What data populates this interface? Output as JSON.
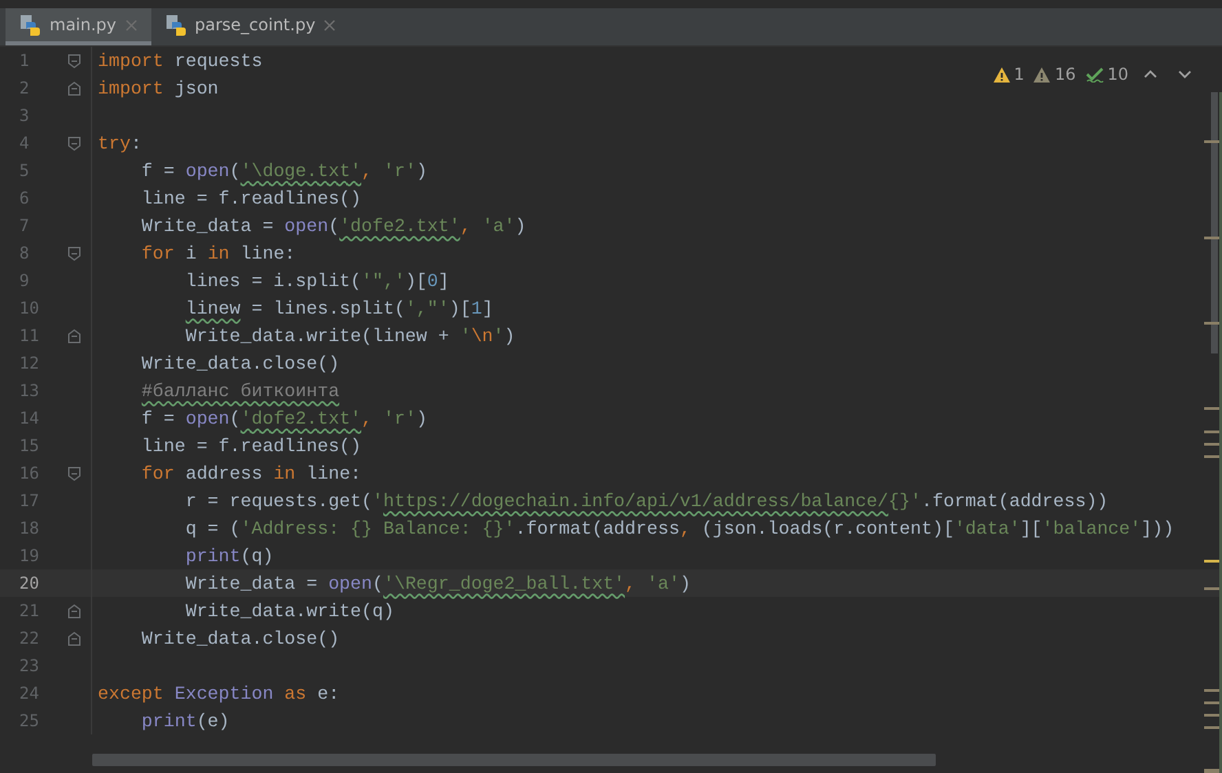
{
  "tabs": [
    {
      "label": "main.py",
      "selected": true
    },
    {
      "label": "parse_coint.py",
      "selected": false
    }
  ],
  "inspections": [
    {
      "kind": "warning",
      "count": "1"
    },
    {
      "kind": "weak",
      "count": "16"
    },
    {
      "kind": "typo",
      "count": "10"
    }
  ],
  "lines": [
    {
      "number": "1",
      "current": false,
      "fold_start": true,
      "fold_end": false,
      "tokens": [
        {
          "text": "import",
          "kind": "keyword"
        },
        {
          "text": " requests",
          "kind": "plain"
        }
      ]
    },
    {
      "number": "2",
      "current": false,
      "fold_start": false,
      "fold_end": true,
      "tokens": [
        {
          "text": "import",
          "kind": "keyword"
        },
        {
          "text": " json",
          "kind": "plain"
        }
      ]
    },
    {
      "number": "3",
      "current": false,
      "fold_start": false,
      "fold_end": false
    },
    {
      "number": "4",
      "current": false,
      "fold_start": true,
      "fold_end": false,
      "tokens": [
        {
          "text": "try",
          "kind": "keyword"
        },
        {
          "text": ":",
          "kind": "plain"
        }
      ]
    },
    {
      "number": "5",
      "current": false,
      "fold_start": false,
      "fold_end": false,
      "tokens": [
        {
          "text": "    f = ",
          "kind": "plain"
        },
        {
          "text": "open",
          "kind": "builtin"
        },
        {
          "text": "(",
          "kind": "plain"
        },
        {
          "text": "'\\doge.txt'",
          "kind": "string",
          "underlined": true
        },
        {
          "text": ", ",
          "kind": "keyword"
        },
        {
          "text": "'r'",
          "kind": "string"
        },
        {
          "text": ")",
          "kind": "plain"
        }
      ]
    },
    {
      "number": "6",
      "current": false,
      "fold_start": false,
      "fold_end": false,
      "tokens": [
        {
          "text": "    line = f.readlines()",
          "kind": "plain"
        }
      ]
    },
    {
      "number": "7",
      "current": false,
      "fold_start": false,
      "fold_end": false,
      "tokens": [
        {
          "text": "    Write_data = ",
          "kind": "plain"
        },
        {
          "text": "open",
          "kind": "builtin"
        },
        {
          "text": "(",
          "kind": "plain"
        },
        {
          "text": "'dofe2.txt'",
          "kind": "string",
          "underlined": true
        },
        {
          "text": ", ",
          "kind": "keyword"
        },
        {
          "text": "'a'",
          "kind": "string"
        },
        {
          "text": ")",
          "kind": "plain"
        }
      ]
    },
    {
      "number": "8",
      "current": false,
      "fold_start": true,
      "fold_end": false,
      "tokens": [
        {
          "text": "    for",
          "kind": "keyword"
        },
        {
          "text": " i ",
          "kind": "plain"
        },
        {
          "text": "in",
          "kind": "keyword"
        },
        {
          "text": " line:",
          "kind": "plain"
        }
      ]
    },
    {
      "number": "9",
      "current": false,
      "fold_start": false,
      "fold_end": false,
      "tokens": [
        {
          "text": "        lines = i.split(",
          "kind": "plain"
        },
        {
          "text": "'\",'",
          "kind": "string"
        },
        {
          "text": ")[",
          "kind": "plain"
        },
        {
          "text": "0",
          "kind": "number"
        },
        {
          "text": "]",
          "kind": "plain"
        }
      ]
    },
    {
      "number": "10",
      "current": false,
      "fold_start": false,
      "fold_end": false,
      "tokens": [
        {
          "text": "        linew",
          "kind": "plain",
          "underlined": true
        },
        {
          "text": " = lines.split(",
          "kind": "plain"
        },
        {
          "text": "',\"'",
          "kind": "string"
        },
        {
          "text": ")[",
          "kind": "plain"
        },
        {
          "text": "1",
          "kind": "number"
        },
        {
          "text": "]",
          "kind": "plain"
        }
      ]
    },
    {
      "number": "11",
      "current": false,
      "fold_start": false,
      "fold_end": true,
      "tokens": [
        {
          "text": "        Write_data.write(linew + ",
          "kind": "plain"
        },
        {
          "text": "'",
          "kind": "string"
        },
        {
          "text": "\\n",
          "kind": "keyword"
        },
        {
          "text": "'",
          "kind": "string"
        },
        {
          "text": ")",
          "kind": "plain"
        }
      ]
    },
    {
      "number": "12",
      "current": false,
      "fold_start": false,
      "fold_end": false,
      "tokens": [
        {
          "text": "    Write_data.close()",
          "kind": "plain"
        }
      ]
    },
    {
      "number": "13",
      "current": false,
      "fold_start": false,
      "fold_end": false,
      "tokens": [
        {
          "text": "    #балланс биткоинта",
          "kind": "comment",
          "underlined": true
        }
      ]
    },
    {
      "number": "14",
      "current": false,
      "fold_start": false,
      "fold_end": false,
      "tokens": [
        {
          "text": "    f = ",
          "kind": "plain"
        },
        {
          "text": "open",
          "kind": "builtin"
        },
        {
          "text": "(",
          "kind": "plain"
        },
        {
          "text": "'dofe2.txt'",
          "kind": "string",
          "underlined": true
        },
        {
          "text": ", ",
          "kind": "keyword"
        },
        {
          "text": "'r'",
          "kind": "string"
        },
        {
          "text": ")",
          "kind": "plain"
        }
      ]
    },
    {
      "number": "15",
      "current": false,
      "fold_start": false,
      "fold_end": false,
      "tokens": [
        {
          "text": "    line = f.readlines()",
          "kind": "plain"
        }
      ]
    },
    {
      "number": "16",
      "current": false,
      "fold_start": true,
      "fold_end": false,
      "tokens": [
        {
          "text": "    for",
          "kind": "keyword"
        },
        {
          "text": " address ",
          "kind": "plain"
        },
        {
          "text": "in",
          "kind": "keyword"
        },
        {
          "text": " line:",
          "kind": "plain"
        }
      ]
    },
    {
      "number": "17",
      "current": false,
      "fold_start": false,
      "fold_end": false,
      "tokens": [
        {
          "text": "        r = requests.get(",
          "kind": "plain"
        },
        {
          "text": "'",
          "kind": "string"
        },
        {
          "text": "https://dogechain.info/api/v1/address/balance/",
          "kind": "string",
          "underlined": true
        },
        {
          "text": "{}'",
          "kind": "string"
        },
        {
          "text": ".format(address))",
          "kind": "plain"
        }
      ]
    },
    {
      "number": "18",
      "current": false,
      "fold_start": false,
      "fold_end": false,
      "tokens": [
        {
          "text": "        q = (",
          "kind": "plain"
        },
        {
          "text": "'Address: {} Balance: {}'",
          "kind": "string"
        },
        {
          "text": ".format(address",
          "kind": "plain"
        },
        {
          "text": ", ",
          "kind": "keyword"
        },
        {
          "text": "(json.loads(r.content)[",
          "kind": "plain"
        },
        {
          "text": "'data'",
          "kind": "string"
        },
        {
          "text": "][",
          "kind": "plain"
        },
        {
          "text": "'balance'",
          "kind": "string"
        },
        {
          "text": "]))",
          "kind": "plain"
        }
      ]
    },
    {
      "number": "19",
      "current": false,
      "fold_start": false,
      "fold_end": false,
      "tokens": [
        {
          "text": "        print",
          "kind": "builtin"
        },
        {
          "text": "(q)",
          "kind": "plain"
        }
      ]
    },
    {
      "number": "20",
      "current": true,
      "fold_start": false,
      "fold_end": false,
      "tokens": [
        {
          "text": "        Write_data = ",
          "kind": "plain"
        },
        {
          "text": "open",
          "kind": "builtin"
        },
        {
          "text": "(",
          "kind": "plain"
        },
        {
          "text": "'\\Regr_doge2_ball.txt'",
          "kind": "string",
          "underlined": true
        },
        {
          "text": ", ",
          "kind": "keyword"
        },
        {
          "text": "'a'",
          "kind": "string"
        },
        {
          "text": ")",
          "kind": "plain"
        }
      ]
    },
    {
      "number": "21",
      "current": false,
      "fold_start": false,
      "fold_end": true,
      "tokens": [
        {
          "text": "        Write_data.write(q)",
          "kind": "plain"
        }
      ]
    },
    {
      "number": "22",
      "current": false,
      "fold_start": false,
      "fold_end": true,
      "tokens": [
        {
          "text": "    Write_data.close()",
          "kind": "plain"
        }
      ]
    },
    {
      "number": "23",
      "current": false,
      "fold_start": false,
      "fold_end": false
    },
    {
      "number": "24",
      "current": false,
      "fold_start": false,
      "fold_end": false,
      "tokens": [
        {
          "text": "except ",
          "kind": "keyword"
        },
        {
          "text": "Exception",
          "kind": "builtin"
        },
        {
          "text": " as ",
          "kind": "keyword"
        },
        {
          "text": "e:",
          "kind": "plain"
        }
      ]
    },
    {
      "number": "25",
      "current": false,
      "fold_start": false,
      "fold_end": false,
      "tokens": [
        {
          "text": "    print",
          "kind": "builtin"
        },
        {
          "text": "(e)",
          "kind": "plain"
        }
      ]
    }
  ]
}
